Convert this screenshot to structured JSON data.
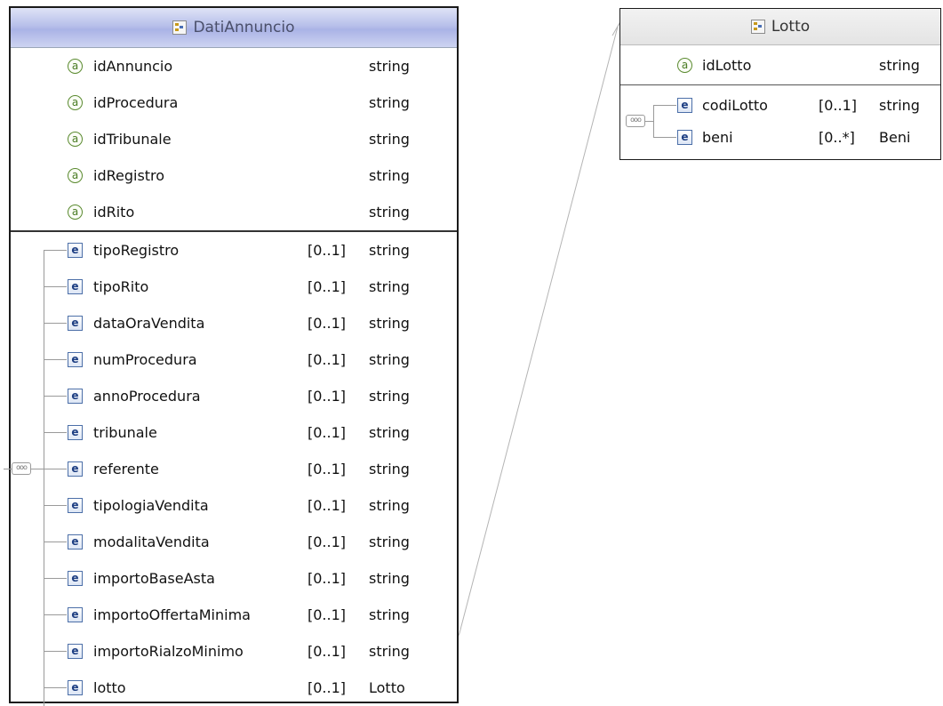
{
  "dati_annuncio": {
    "title": "DatiAnnuncio",
    "attributes": [
      {
        "name": "idAnnuncio",
        "type": "string"
      },
      {
        "name": "idProcedura",
        "type": "string"
      },
      {
        "name": "idTribunale",
        "type": "string"
      },
      {
        "name": "idRegistro",
        "type": "string"
      },
      {
        "name": "idRito",
        "type": "string"
      }
    ],
    "elements": [
      {
        "name": "tipoRegistro",
        "occurs": "[0..1]",
        "type": "string"
      },
      {
        "name": "tipoRito",
        "occurs": "[0..1]",
        "type": "string"
      },
      {
        "name": "dataOraVendita",
        "occurs": "[0..1]",
        "type": "string"
      },
      {
        "name": "numProcedura",
        "occurs": "[0..1]",
        "type": "string"
      },
      {
        "name": "annoProcedura",
        "occurs": "[0..1]",
        "type": "string"
      },
      {
        "name": "tribunale",
        "occurs": "[0..1]",
        "type": "string"
      },
      {
        "name": "referente",
        "occurs": "[0..1]",
        "type": "string"
      },
      {
        "name": "tipologiaVendita",
        "occurs": "[0..1]",
        "type": "string"
      },
      {
        "name": "modalitaVendita",
        "occurs": "[0..1]",
        "type": "string"
      },
      {
        "name": "importoBaseAsta",
        "occurs": "[0..1]",
        "type": "string"
      },
      {
        "name": "importoOffertaMinima",
        "occurs": "[0..1]",
        "type": "string"
      },
      {
        "name": "importoRialzoMinimo",
        "occurs": "[0..1]",
        "type": "string"
      },
      {
        "name": "lotto",
        "occurs": "[0..1]",
        "type": "Lotto"
      }
    ]
  },
  "lotto": {
    "title": "Lotto",
    "attributes": [
      {
        "name": "idLotto",
        "type": "string"
      }
    ],
    "elements": [
      {
        "name": "codiLotto",
        "occurs": "[0..1]",
        "type": "string"
      },
      {
        "name": "beni",
        "occurs": "[0..*]",
        "type": "Beni"
      }
    ]
  },
  "icons": {
    "attribute": "a",
    "element": "e",
    "sequence": "ooo"
  },
  "colors": {
    "header_gradient": "#aab3e6",
    "attribute_icon": "#4a7c24",
    "element_icon": "#1d3e82"
  }
}
